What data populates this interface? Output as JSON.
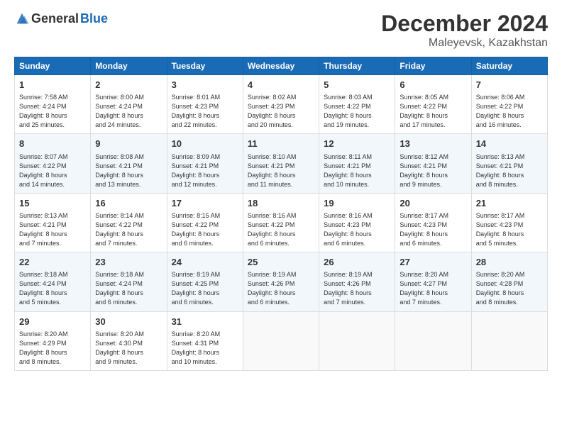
{
  "header": {
    "logo_general": "General",
    "logo_blue": "Blue",
    "month": "December 2024",
    "location": "Maleyevsk, Kazakhstan"
  },
  "days_of_week": [
    "Sunday",
    "Monday",
    "Tuesday",
    "Wednesday",
    "Thursday",
    "Friday",
    "Saturday"
  ],
  "weeks": [
    [
      {
        "day": "1",
        "info": "Sunrise: 7:58 AM\nSunset: 4:24 PM\nDaylight: 8 hours\nand 25 minutes."
      },
      {
        "day": "2",
        "info": "Sunrise: 8:00 AM\nSunset: 4:24 PM\nDaylight: 8 hours\nand 24 minutes."
      },
      {
        "day": "3",
        "info": "Sunrise: 8:01 AM\nSunset: 4:23 PM\nDaylight: 8 hours\nand 22 minutes."
      },
      {
        "day": "4",
        "info": "Sunrise: 8:02 AM\nSunset: 4:23 PM\nDaylight: 8 hours\nand 20 minutes."
      },
      {
        "day": "5",
        "info": "Sunrise: 8:03 AM\nSunset: 4:22 PM\nDaylight: 8 hours\nand 19 minutes."
      },
      {
        "day": "6",
        "info": "Sunrise: 8:05 AM\nSunset: 4:22 PM\nDaylight: 8 hours\nand 17 minutes."
      },
      {
        "day": "7",
        "info": "Sunrise: 8:06 AM\nSunset: 4:22 PM\nDaylight: 8 hours\nand 16 minutes."
      }
    ],
    [
      {
        "day": "8",
        "info": "Sunrise: 8:07 AM\nSunset: 4:22 PM\nDaylight: 8 hours\nand 14 minutes."
      },
      {
        "day": "9",
        "info": "Sunrise: 8:08 AM\nSunset: 4:21 PM\nDaylight: 8 hours\nand 13 minutes."
      },
      {
        "day": "10",
        "info": "Sunrise: 8:09 AM\nSunset: 4:21 PM\nDaylight: 8 hours\nand 12 minutes."
      },
      {
        "day": "11",
        "info": "Sunrise: 8:10 AM\nSunset: 4:21 PM\nDaylight: 8 hours\nand 11 minutes."
      },
      {
        "day": "12",
        "info": "Sunrise: 8:11 AM\nSunset: 4:21 PM\nDaylight: 8 hours\nand 10 minutes."
      },
      {
        "day": "13",
        "info": "Sunrise: 8:12 AM\nSunset: 4:21 PM\nDaylight: 8 hours\nand 9 minutes."
      },
      {
        "day": "14",
        "info": "Sunrise: 8:13 AM\nSunset: 4:21 PM\nDaylight: 8 hours\nand 8 minutes."
      }
    ],
    [
      {
        "day": "15",
        "info": "Sunrise: 8:13 AM\nSunset: 4:21 PM\nDaylight: 8 hours\nand 7 minutes."
      },
      {
        "day": "16",
        "info": "Sunrise: 8:14 AM\nSunset: 4:22 PM\nDaylight: 8 hours\nand 7 minutes."
      },
      {
        "day": "17",
        "info": "Sunrise: 8:15 AM\nSunset: 4:22 PM\nDaylight: 8 hours\nand 6 minutes."
      },
      {
        "day": "18",
        "info": "Sunrise: 8:16 AM\nSunset: 4:22 PM\nDaylight: 8 hours\nand 6 minutes."
      },
      {
        "day": "19",
        "info": "Sunrise: 8:16 AM\nSunset: 4:23 PM\nDaylight: 8 hours\nand 6 minutes."
      },
      {
        "day": "20",
        "info": "Sunrise: 8:17 AM\nSunset: 4:23 PM\nDaylight: 8 hours\nand 6 minutes."
      },
      {
        "day": "21",
        "info": "Sunrise: 8:17 AM\nSunset: 4:23 PM\nDaylight: 8 hours\nand 5 minutes."
      }
    ],
    [
      {
        "day": "22",
        "info": "Sunrise: 8:18 AM\nSunset: 4:24 PM\nDaylight: 8 hours\nand 5 minutes."
      },
      {
        "day": "23",
        "info": "Sunrise: 8:18 AM\nSunset: 4:24 PM\nDaylight: 8 hours\nand 6 minutes."
      },
      {
        "day": "24",
        "info": "Sunrise: 8:19 AM\nSunset: 4:25 PM\nDaylight: 8 hours\nand 6 minutes."
      },
      {
        "day": "25",
        "info": "Sunrise: 8:19 AM\nSunset: 4:26 PM\nDaylight: 8 hours\nand 6 minutes."
      },
      {
        "day": "26",
        "info": "Sunrise: 8:19 AM\nSunset: 4:26 PM\nDaylight: 8 hours\nand 7 minutes."
      },
      {
        "day": "27",
        "info": "Sunrise: 8:20 AM\nSunset: 4:27 PM\nDaylight: 8 hours\nand 7 minutes."
      },
      {
        "day": "28",
        "info": "Sunrise: 8:20 AM\nSunset: 4:28 PM\nDaylight: 8 hours\nand 8 minutes."
      }
    ],
    [
      {
        "day": "29",
        "info": "Sunrise: 8:20 AM\nSunset: 4:29 PM\nDaylight: 8 hours\nand 8 minutes."
      },
      {
        "day": "30",
        "info": "Sunrise: 8:20 AM\nSunset: 4:30 PM\nDaylight: 8 hours\nand 9 minutes."
      },
      {
        "day": "31",
        "info": "Sunrise: 8:20 AM\nSunset: 4:31 PM\nDaylight: 8 hours\nand 10 minutes."
      },
      {
        "day": "",
        "info": ""
      },
      {
        "day": "",
        "info": ""
      },
      {
        "day": "",
        "info": ""
      },
      {
        "day": "",
        "info": ""
      }
    ]
  ]
}
